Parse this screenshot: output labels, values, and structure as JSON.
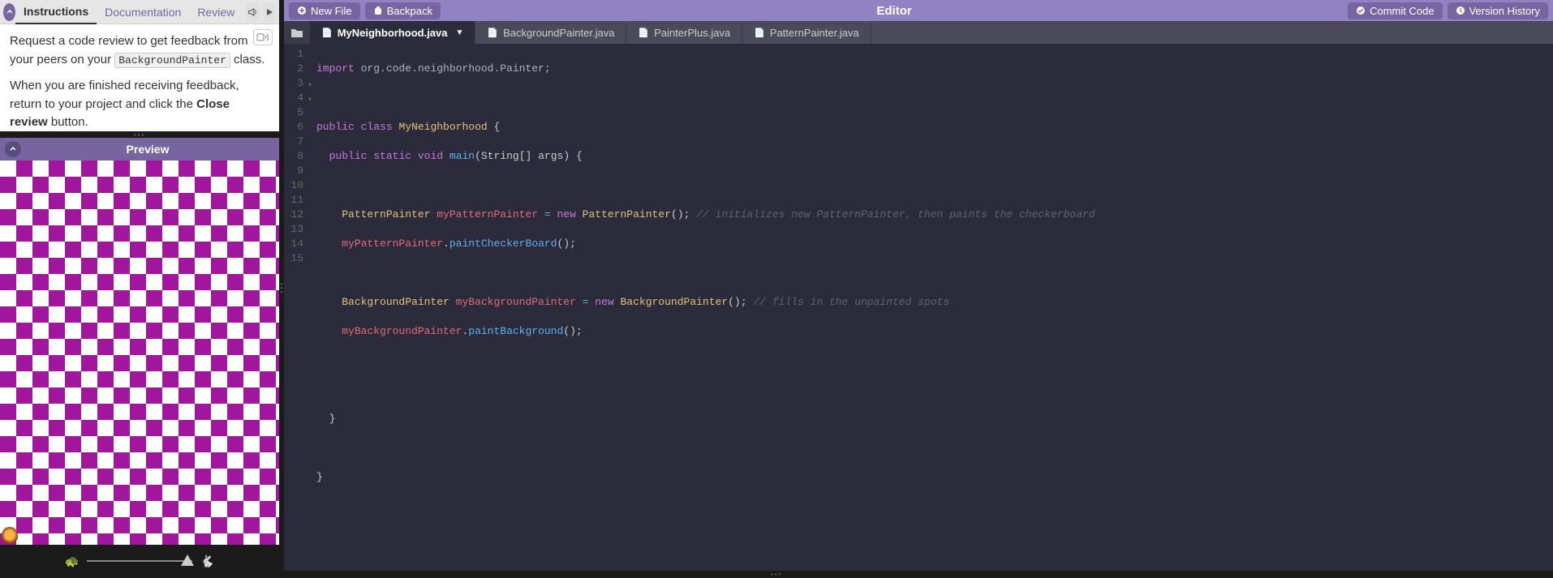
{
  "leftTabs": {
    "instructions": "Instructions",
    "documentation": "Documentation",
    "review": "Review"
  },
  "instructions": {
    "line1_pre": "Request a code review to get feedback from your peers on your ",
    "code_tag": "BackgroundPainter",
    "line1_post": " class.",
    "line2_pre": "When you are finished receiving feedback, return to your project and click the ",
    "bold": "Close review",
    "line2_post": " button."
  },
  "preview": {
    "title": "Preview"
  },
  "toolbar": {
    "newFile": "New File",
    "backpack": "Backpack",
    "editorTitle": "Editor",
    "commit": "Commit Code",
    "history": "Version History"
  },
  "files": {
    "f0": "MyNeighborhood.java",
    "f1": "BackgroundPainter.java",
    "f2": "PainterPlus.java",
    "f3": "PatternPainter.java"
  },
  "code": {
    "l1": {
      "kw": "import",
      "pkg": " org.code.neighborhood.Painter;"
    },
    "l3": {
      "kw1": "public",
      "kw2": "class",
      "cls": "MyNeighborhood",
      "b": " {"
    },
    "l4": {
      "kw1": "public",
      "kw2": "static",
      "kw3": "void",
      "fn": "main",
      "args": "(String[] args)",
      "b": " {"
    },
    "l6": {
      "cls": "PatternPainter",
      "var": " myPatternPainter",
      "op": " = ",
      "kw": "new",
      "cls2": " PatternPainter",
      "call": "();",
      "cmt": " // initializes new PatternPainter, then paints the checkerboard"
    },
    "l7": {
      "var": "myPatternPainter",
      "dot": ".",
      "fn": "paintCheckerBoard",
      "call": "();"
    },
    "l9": {
      "cls": "BackgroundPainter",
      "var": " myBackgroundPainter",
      "op": " = ",
      "kw": "new",
      "cls2": " BackgroundPainter",
      "call": "();",
      "cmt": " // fills in the unpainted spots"
    },
    "l10": {
      "var": "myBackgroundPainter",
      "dot": ".",
      "fn": "paintBackground",
      "call": "();"
    },
    "l13": {
      "b": "  }"
    },
    "l15": {
      "b": "}"
    }
  },
  "lineNumbers": [
    "1",
    "2",
    "3",
    "4",
    "5",
    "6",
    "7",
    "8",
    "9",
    "10",
    "11",
    "12",
    "13",
    "14",
    "15"
  ]
}
